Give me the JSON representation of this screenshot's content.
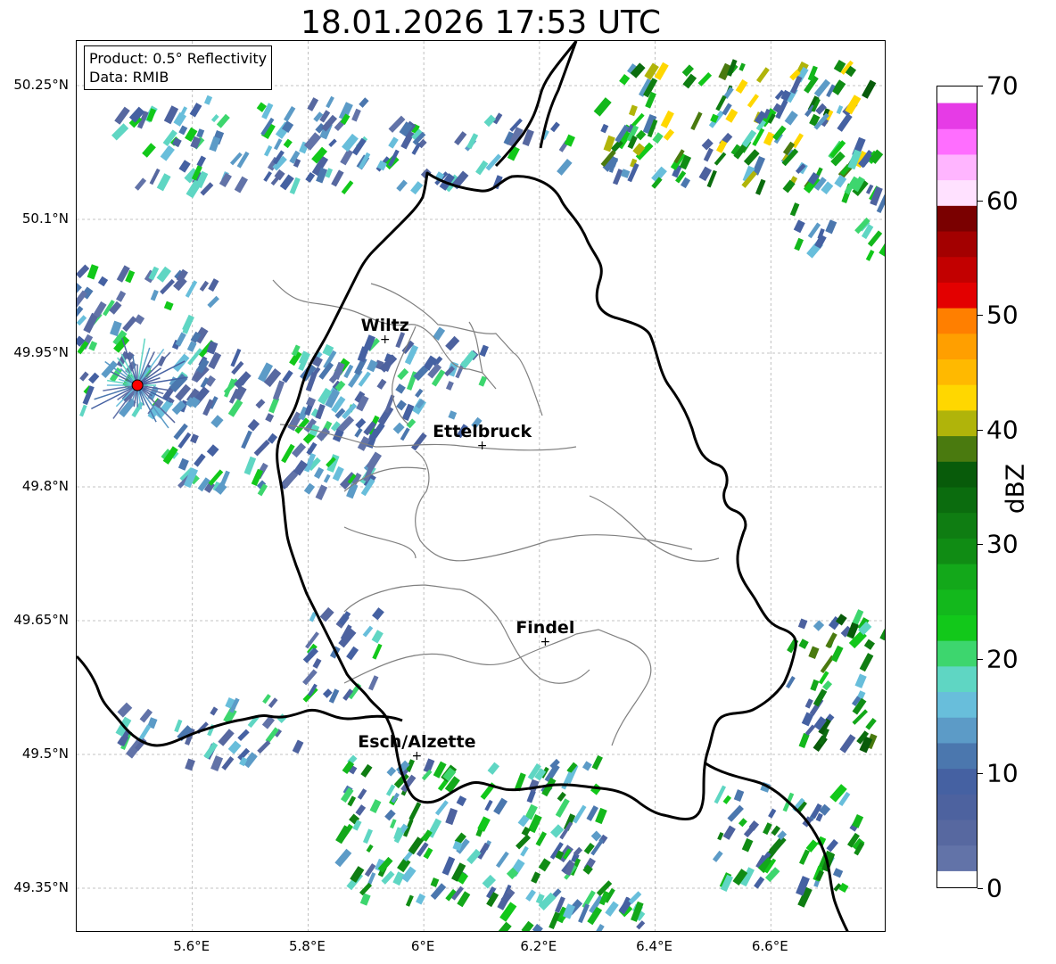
{
  "title": "18.01.2026 17:53 UTC",
  "info": {
    "product": "Product: 0.5° Reflectivity",
    "data_source": "Data: RMIB"
  },
  "lat_ticks": [
    {
      "value": 50.25,
      "label": "50.25°N"
    },
    {
      "value": 50.1,
      "label": "50.1°N"
    },
    {
      "value": 49.95,
      "label": "49.95°N"
    },
    {
      "value": 49.8,
      "label": "49.8°N"
    },
    {
      "value": 49.65,
      "label": "49.65°N"
    },
    {
      "value": 49.5,
      "label": "49.5°N"
    },
    {
      "value": 49.35,
      "label": "49.35°N"
    }
  ],
  "lon_ticks": [
    {
      "value": 5.6,
      "label": "5.6°E"
    },
    {
      "value": 5.8,
      "label": "5.8°E"
    },
    {
      "value": 6.0,
      "label": "6°E"
    },
    {
      "value": 6.2,
      "label": "6.2°E"
    },
    {
      "value": 6.4,
      "label": "6.4°E"
    },
    {
      "value": 6.6,
      "label": "6.6°E"
    }
  ],
  "extent": {
    "lon_min": 5.4,
    "lon_max": 6.8,
    "lat_min": 49.3,
    "lat_max": 50.3
  },
  "cities": [
    {
      "name": "Wiltz",
      "lon": 5.933,
      "lat": 49.966
    },
    {
      "name": "Ettelbruck",
      "lon": 6.101,
      "lat": 49.847
    },
    {
      "name": "Findel",
      "lon": 6.21,
      "lat": 49.627
    },
    {
      "name": "Esch/Alzette",
      "lon": 5.988,
      "lat": 49.499
    }
  ],
  "radar_site": {
    "lon": 5.505,
    "lat": 49.914,
    "color": "#ff0000"
  },
  "colorbar": {
    "unit": "dBZ",
    "min": 0,
    "max": 70,
    "ticks": [
      {
        "value": 0,
        "label": "0"
      },
      {
        "value": 10,
        "label": "10"
      },
      {
        "value": 20,
        "label": "20"
      },
      {
        "value": 30,
        "label": "30"
      },
      {
        "value": 40,
        "label": "40"
      },
      {
        "value": 50,
        "label": "50"
      },
      {
        "value": 60,
        "label": "60"
      },
      {
        "value": 70,
        "label": "70"
      }
    ],
    "colors": [
      "#6273a8",
      "#5768a0",
      "#4d629f",
      "#4561a2",
      "#4b77ae",
      "#5c9bc7",
      "#68bedb",
      "#5fd6c3",
      "#3dd66e",
      "#12c81a",
      "#13b81c",
      "#13a81a",
      "#108c14",
      "#0f7d12",
      "#0b6c0e",
      "#085b0a",
      "#4a7a0f",
      "#b0b40a",
      "#ffd700",
      "#ffb900",
      "#ff9f00",
      "#ff7f00",
      "#e30000",
      "#c20000",
      "#a30000",
      "#7a0000",
      "#ffe1ff",
      "#ffb5ff",
      "#ff6eff",
      "#e63be6"
    ]
  }
}
